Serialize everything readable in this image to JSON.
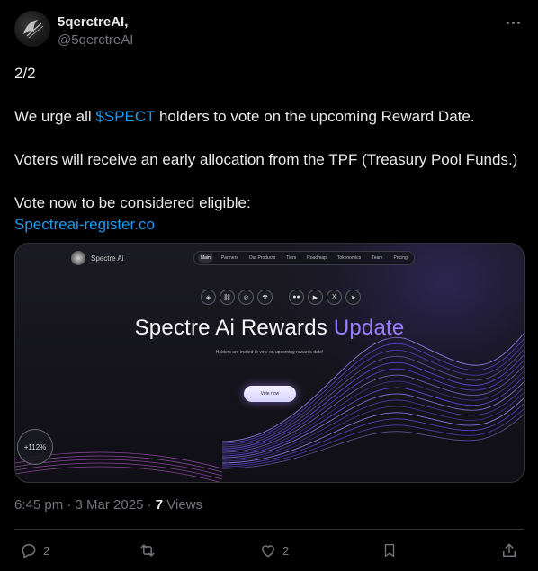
{
  "author": {
    "display_name": "5qerctreAI,",
    "handle": "@5qerctreAI"
  },
  "tweet": {
    "line1": "2/2",
    "line2_prefix": "We urge all ",
    "line2_cashtag": "$SPECT",
    "line2_suffix": " holders to vote on the upcoming Reward Date.",
    "line3": "Voters will receive an early allocation from the TPF (Treasury Pool Funds.)",
    "line4": "Vote now to be considered eligible:",
    "link": "Spectreai-register.co"
  },
  "media": {
    "brand": "Spectre Ai",
    "nav": [
      "Main",
      "Partners",
      "Our Products",
      "Tiers",
      "Roadmap",
      "Tokenomics",
      "Team",
      "Pricing"
    ],
    "title_main": "Spectre Ai Rewards ",
    "title_accent": "Update",
    "subtitle": "Holders are invited to vote on upcoming rewards date!",
    "button": "Vote now",
    "badge": "+112%",
    "social_icons": [
      "binance-icon",
      "chain-icon",
      "coin-icon",
      "tool-icon",
      "medium-icon",
      "youtube-icon",
      "x-icon",
      "telegram-icon"
    ],
    "social_glyphs": [
      "◈",
      "⛓",
      "◎",
      "⚒",
      "●●",
      "▶",
      "X",
      "➤"
    ]
  },
  "meta": {
    "time": "6:45 pm",
    "sep": " · ",
    "date": "3 Mar 2025",
    "views_count": "7",
    "views_label": " Views"
  },
  "actions": {
    "replies": "2",
    "likes": "2"
  },
  "colors": {
    "accent": "#1d9bf0",
    "title_accent": "#9a7cff",
    "wave": "#7a5cff"
  }
}
